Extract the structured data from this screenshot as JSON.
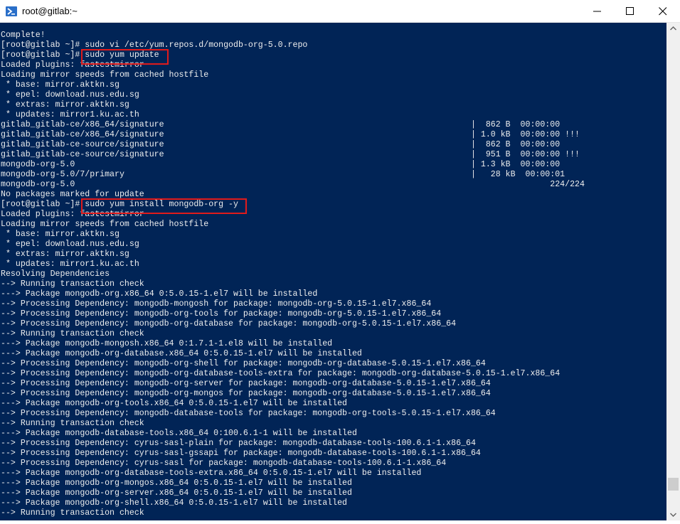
{
  "window": {
    "title": "root@gitlab:~",
    "icons": {
      "app": "powershell-icon",
      "minimize": "minimize-icon",
      "maximize": "maximize-icon",
      "close": "close-icon"
    }
  },
  "terminal": {
    "background": "#012456",
    "text_color": "#eeeeee",
    "highlight_color": "#e01b1b",
    "lines": [
      "Complete!",
      "[root@gitlab ~]# sudo vi /etc/yum.repos.d/mongodb-org-5.0.repo",
      "[root@gitlab ~]# sudo yum update",
      "Loaded plugins: fastestmirror",
      "Loading mirror speeds from cached hostfile",
      " * base: mirror.aktkn.sg",
      " * epel: download.nus.edu.sg",
      " * extras: mirror.aktkn.sg",
      " * updates: mirror1.ku.ac.th",
      "gitlab_gitlab-ce/x86_64/signature                                                              |  862 B  00:00:00",
      "gitlab_gitlab-ce/x86_64/signature                                                              | 1.0 kB  00:00:00 !!!",
      "gitlab_gitlab-ce-source/signature                                                              |  862 B  00:00:00",
      "gitlab_gitlab-ce-source/signature                                                              |  951 B  00:00:00 !!!",
      "mongodb-org-5.0                                                                                | 1.3 kB  00:00:00",
      "mongodb-org-5.0/7/primary                                                                      |   28 kB  00:00:01",
      "mongodb-org-5.0                                                                                                224/224",
      "No packages marked for update",
      "[root@gitlab ~]# sudo yum install mongodb-org -y",
      "Loaded plugins: fastestmirror",
      "Loading mirror speeds from cached hostfile",
      " * base: mirror.aktkn.sg",
      " * epel: download.nus.edu.sg",
      " * extras: mirror.aktkn.sg",
      " * updates: mirror1.ku.ac.th",
      "Resolving Dependencies",
      "--> Running transaction check",
      "---> Package mongodb-org.x86_64 0:5.0.15-1.el7 will be installed",
      "--> Processing Dependency: mongodb-mongosh for package: mongodb-org-5.0.15-1.el7.x86_64",
      "--> Processing Dependency: mongodb-org-tools for package: mongodb-org-5.0.15-1.el7.x86_64",
      "--> Processing Dependency: mongodb-org-database for package: mongodb-org-5.0.15-1.el7.x86_64",
      "--> Running transaction check",
      "---> Package mongodb-mongosh.x86_64 0:1.7.1-1.el8 will be installed",
      "---> Package mongodb-org-database.x86_64 0:5.0.15-1.el7 will be installed",
      "--> Processing Dependency: mongodb-org-shell for package: mongodb-org-database-5.0.15-1.el7.x86_64",
      "--> Processing Dependency: mongodb-org-database-tools-extra for package: mongodb-org-database-5.0.15-1.el7.x86_64",
      "--> Processing Dependency: mongodb-org-server for package: mongodb-org-database-5.0.15-1.el7.x86_64",
      "--> Processing Dependency: mongodb-org-mongos for package: mongodb-org-database-5.0.15-1.el7.x86_64",
      "---> Package mongodb-org-tools.x86_64 0:5.0.15-1.el7 will be installed",
      "--> Processing Dependency: mongodb-database-tools for package: mongodb-org-tools-5.0.15-1.el7.x86_64",
      "--> Running transaction check",
      "---> Package mongodb-database-tools.x86_64 0:100.6.1-1 will be installed",
      "--> Processing Dependency: cyrus-sasl-plain for package: mongodb-database-tools-100.6.1-1.x86_64",
      "--> Processing Dependency: cyrus-sasl-gssapi for package: mongodb-database-tools-100.6.1-1.x86_64",
      "--> Processing Dependency: cyrus-sasl for package: mongodb-database-tools-100.6.1-1.x86_64",
      "---> Package mongodb-org-database-tools-extra.x86_64 0:5.0.15-1.el7 will be installed",
      "---> Package mongodb-org-mongos.x86_64 0:5.0.15-1.el7 will be installed",
      "---> Package mongodb-org-server.x86_64 0:5.0.15-1.el7 will be installed",
      "---> Package mongodb-org-shell.x86_64 0:5.0.15-1.el7 will be installed",
      "--> Running transaction check"
    ]
  }
}
